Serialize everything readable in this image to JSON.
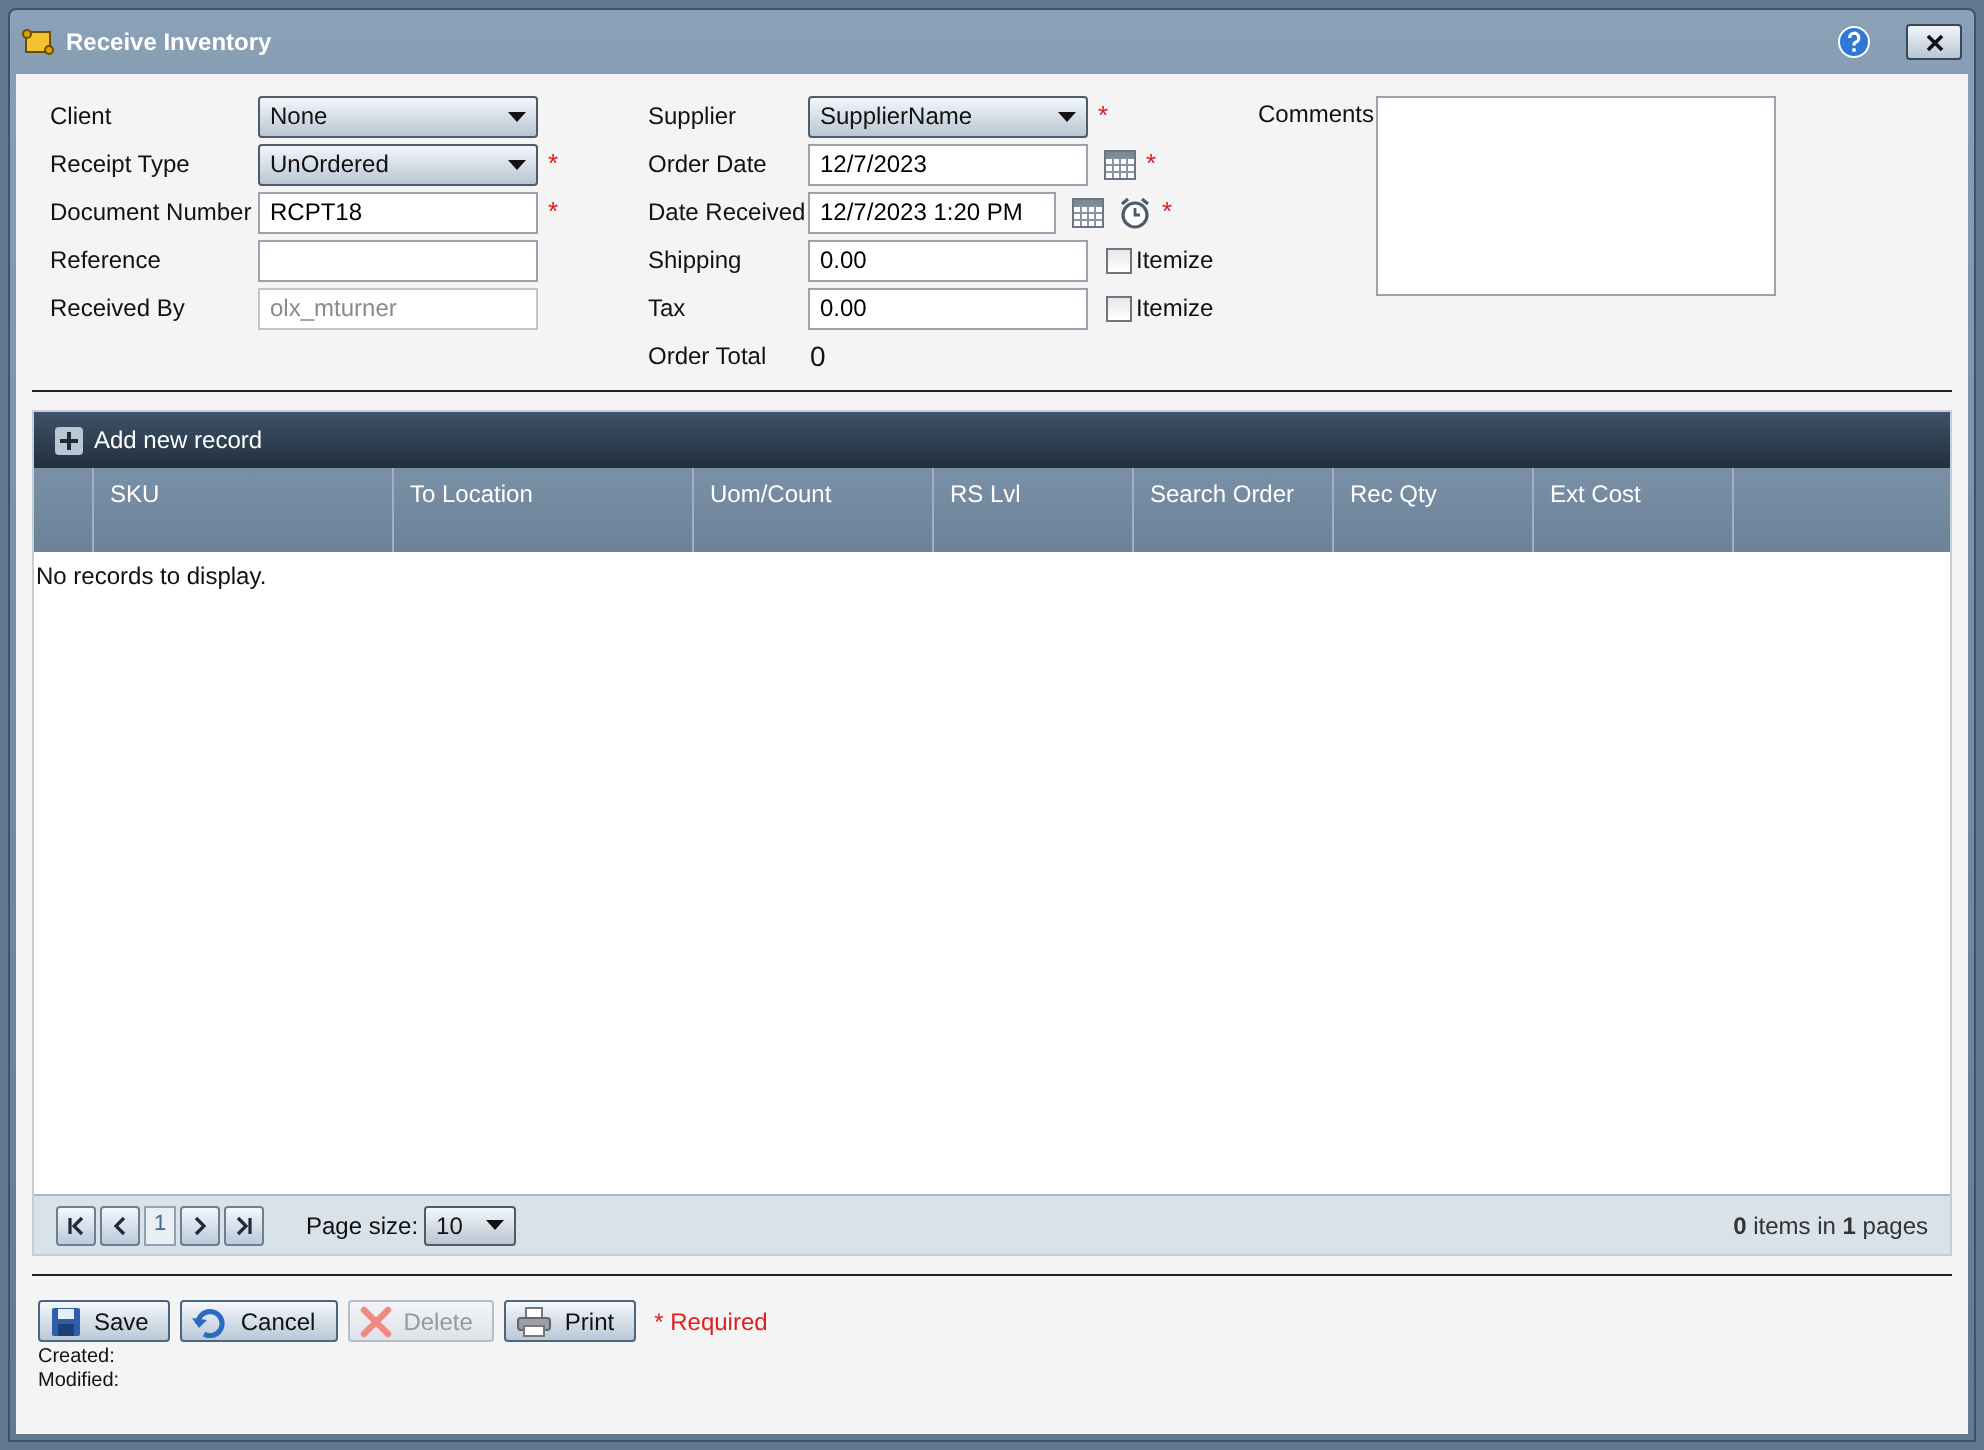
{
  "window": {
    "title": "Receive Inventory"
  },
  "form_left": [
    {
      "label": "Client",
      "kind": "select",
      "value": "None"
    },
    {
      "label": "Receipt Type",
      "kind": "select",
      "value": "UnOrdered",
      "required_mark": "*"
    },
    {
      "label": "Document Number",
      "kind": "text",
      "value": "RCPT18",
      "required_mark": "*"
    },
    {
      "label": "Reference",
      "kind": "text"
    },
    {
      "label": "Received By",
      "kind": "text",
      "value": "olx_mturner",
      "disabled": true
    }
  ],
  "form_middle": [
    {
      "label": "Supplier",
      "kind": "select",
      "value": "SupplierName",
      "required_mark": "*"
    },
    {
      "label": "Order Date",
      "kind": "date",
      "value": "12/7/2023",
      "required_mark": "*"
    },
    {
      "label": "Date Received",
      "kind": "datetime",
      "value": "12/7/2023 1:20 PM",
      "required_mark": "*"
    },
    {
      "label": "Shipping",
      "kind": "amount",
      "value": "0.00",
      "itemize": {
        "label": "Itemize",
        "checked": false
      }
    },
    {
      "label": "Tax",
      "kind": "amount",
      "value": "0.00",
      "itemize": {
        "label": "Itemize",
        "checked": false
      }
    },
    {
      "label": "Order Total",
      "kind": "total",
      "value": "0"
    }
  ],
  "comments": {
    "label": "Comments"
  },
  "grid": {
    "add_label": "Add new record",
    "columns": [
      "SKU",
      "To Location",
      "Uom/Count",
      "RS Lvl",
      "Search Order",
      "Rec Qty",
      "Ext Cost"
    ],
    "empty_text": "No records to display."
  },
  "pager": {
    "page": "1",
    "page_size_label": "Page size:",
    "page_size": "10",
    "summary": "**0** items in **1** pages"
  },
  "buttons": [
    {
      "label": "Save",
      "kind": "save",
      "disabled": false
    },
    {
      "label": "Cancel",
      "kind": "cancel",
      "disabled": false
    },
    {
      "label": "Delete",
      "kind": "delete",
      "disabled": true
    },
    {
      "label": "Print",
      "kind": "print",
      "disabled": false
    }
  ],
  "required_note": "* Required",
  "audit": [
    "Created:",
    "Modified:"
  ]
}
